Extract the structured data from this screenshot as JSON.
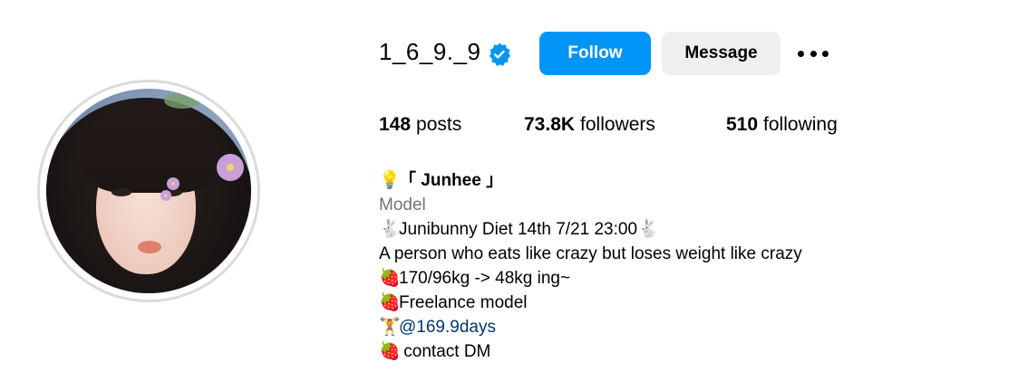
{
  "profile": {
    "username": "1_6_9._9",
    "verified": true,
    "accent_color": "#0095f6"
  },
  "actions": {
    "follow_label": "Follow",
    "message_label": "Message",
    "more_label": "•••"
  },
  "stats": {
    "posts_count": "148",
    "posts_label": "posts",
    "followers_count": "73.8K",
    "followers_label": "followers",
    "following_count": "510",
    "following_label": "following"
  },
  "bio": {
    "bulb_emoji": "💡",
    "name_line": "「 Junhee 」",
    "category": "Model",
    "rabbit_emoji": "🐇",
    "strawberry_emoji": "🍓",
    "dumbbell_emoji": "🏋",
    "line1": "Junibunny Diet 14th 7/21 23:00",
    "line2": "A person who eats like crazy but loses weight like crazy",
    "line3": "170/96kg -> 48kg ing~",
    "line4": "Freelance model",
    "mention": "@169.9days",
    "line6": " contact DM"
  },
  "icons": {
    "verified": "verified-badge-icon",
    "more": "more-options-icon"
  }
}
